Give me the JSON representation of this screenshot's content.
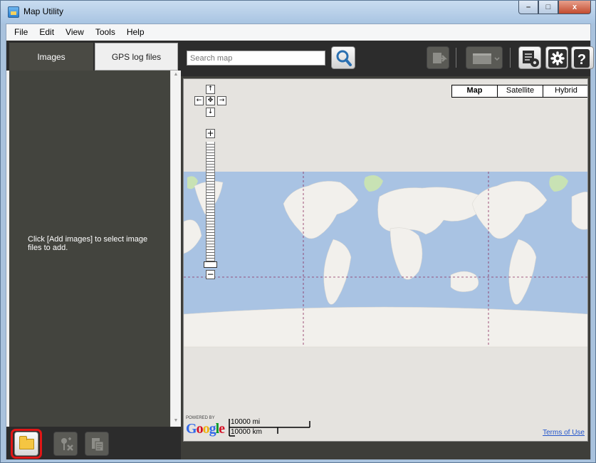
{
  "window": {
    "title": "Map Utility",
    "controls": {
      "minimize": "–",
      "maximize": "□",
      "close": "x"
    }
  },
  "menu": {
    "items": [
      {
        "label": "File"
      },
      {
        "label": "Edit"
      },
      {
        "label": "View"
      },
      {
        "label": "Tools"
      },
      {
        "label": "Help"
      }
    ]
  },
  "left_panel": {
    "tabs": [
      {
        "label": "Images",
        "active": true
      },
      {
        "label": "GPS log files",
        "active": false
      }
    ],
    "hint": "Click [Add images] to select image files to add.",
    "bottom_buttons": [
      {
        "name": "add-images",
        "icon": "folder-icon",
        "enabled": true,
        "highlighted": true
      },
      {
        "name": "geotag",
        "icon": "geotag-icon",
        "enabled": false
      },
      {
        "name": "edit",
        "icon": "edit-icon",
        "enabled": false
      }
    ]
  },
  "toolbar": {
    "search_placeholder": "Search map",
    "buttons": [
      {
        "name": "search",
        "icon": "magnifier-icon",
        "enabled": true
      },
      {
        "name": "export",
        "icon": "export-icon",
        "enabled": false
      },
      {
        "name": "display",
        "icon": "window-icon",
        "enabled": false
      },
      {
        "name": "log-settings",
        "icon": "log-settings-icon",
        "enabled": true
      },
      {
        "name": "settings",
        "icon": "gear-icon",
        "enabled": true
      },
      {
        "name": "help",
        "icon": "question-icon",
        "enabled": true
      }
    ]
  },
  "map": {
    "types": [
      {
        "label": "Map",
        "selected": true
      },
      {
        "label": "Satellite",
        "selected": false
      },
      {
        "label": "Hybrid",
        "selected": false
      }
    ],
    "pan": {
      "up": "↑",
      "down": "↓",
      "left": "←",
      "right": "→",
      "center": "✥"
    },
    "zoom": {
      "in": "+",
      "out": "−"
    },
    "powered_by": "POWERED BY",
    "brand": "Google",
    "scale": {
      "miles": "10000 mi",
      "km": "10000 km"
    },
    "terms": "Terms of Use",
    "colors": {
      "ocean": "#a9c3e3",
      "land": "#f2f0ec",
      "ice": "#c8e2b4"
    }
  },
  "colors": {
    "highlight": "#e01616",
    "panel": "#43443e",
    "toolbar": "#2c2c2c"
  }
}
